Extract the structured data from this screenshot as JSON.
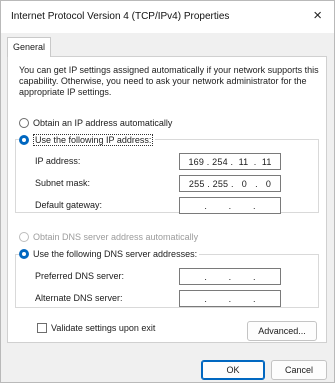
{
  "window": {
    "title": "Internet Protocol Version 4 (TCP/IPv4) Properties",
    "close_glyph": "×"
  },
  "tabs": [
    {
      "label": "General"
    }
  ],
  "description": "You can get IP settings assigned automatically if your network supports this capability. Otherwise, you need to ask your network administrator for the appropriate IP settings.",
  "ip_mode": {
    "auto_label": "Obtain an IP address automatically",
    "manual_label": "Use the following IP address:",
    "selected": "manual"
  },
  "ip_fields": {
    "ip_address": {
      "label": "IP address:",
      "value": "169 . 254 .  11  .  11"
    },
    "subnet_mask": {
      "label": "Subnet mask:",
      "value": "255 . 255 .   0   .   0"
    },
    "default_gateway": {
      "label": "Default gateway:",
      "value": "     .        .        .     "
    }
  },
  "dns_mode": {
    "auto_label": "Obtain DNS server address automatically",
    "manual_label": "Use the following DNS server addresses:",
    "selected": "manual",
    "auto_disabled": true
  },
  "dns_fields": {
    "preferred": {
      "label": "Preferred DNS server:",
      "value": "     .        .        .     "
    },
    "alternate": {
      "label": "Alternate DNS server:",
      "value": "     .        .        .     "
    }
  },
  "validate": {
    "label": "Validate settings upon exit",
    "checked": false
  },
  "buttons": {
    "advanced": "Advanced...",
    "ok": "OK",
    "cancel": "Cancel"
  },
  "colors": {
    "accent": "#0067c0",
    "window_bg": "#f0f0f0",
    "panel_bg": "#ffffff"
  }
}
